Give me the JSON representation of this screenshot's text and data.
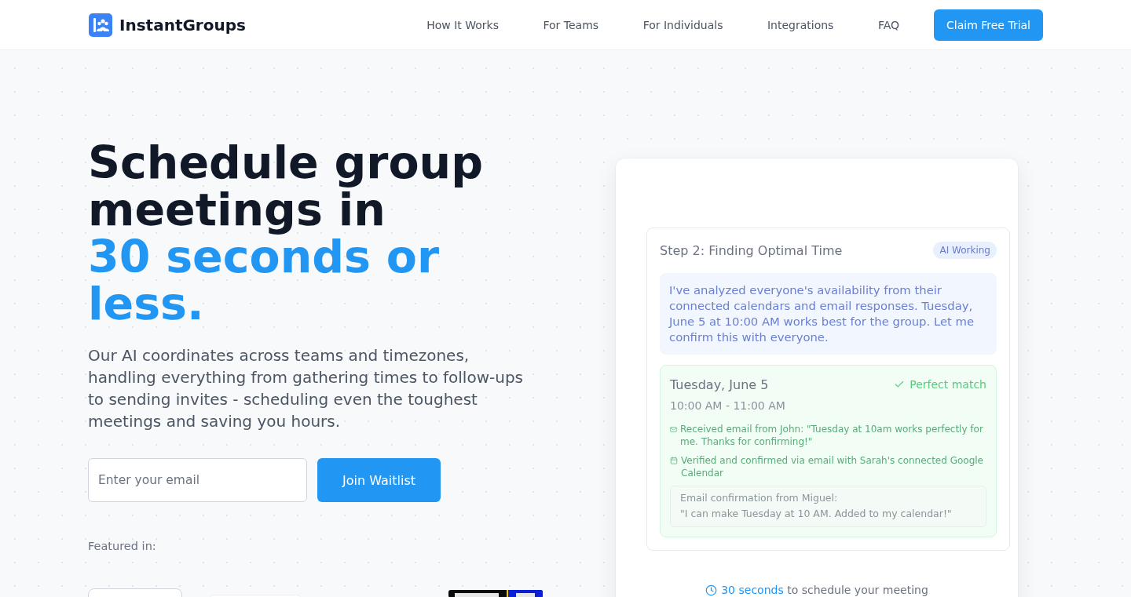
{
  "header": {
    "brand": "InstantGroups",
    "nav": [
      "How It Works",
      "For Teams",
      "For Individuals",
      "Integrations",
      "FAQ"
    ],
    "cta": "Claim Free Trial"
  },
  "hero": {
    "title": "Schedule group meetings in",
    "title_highlight": "30 seconds or less.",
    "description": "Our AI coordinates across teams and timezones, handling everything from gathering times to follow-ups to sending invites - scheduling even the toughest meetings and saving you hours.",
    "email_field": {
      "placeholder": "Enter your email"
    },
    "submit": "Join Waitlist",
    "featured_label": "Featured in:"
  },
  "demo": {
    "step_title": "Step 2: Finding Optimal Time",
    "status_badge": "AI Working",
    "ai_message": "I've analyzed everyone's availability from their connected calendars and email responses. Tuesday, June 5 at 10:00 AM works best for the group. Let me confirm this with everyone.",
    "match": {
      "date": "Tuesday, June 5",
      "status": "Perfect match",
      "time": "10:00 AM - 11:00 AM",
      "confirmations": [
        {
          "kind": "email",
          "text": "Received email from John: \"Tuesday at 10am works perfectly for me. Thanks for confirming!\""
        },
        {
          "kind": "calendar",
          "text": "Verified and confirmed via email with Sarah's connected Google Calendar"
        }
      ],
      "pending": {
        "title": "Email confirmation from Miguel:",
        "quote": "\"I can make Tuesday at 10 AM. Added to my calendar!\"",
        "faded": true
      }
    },
    "footer": {
      "highlight": "30 seconds",
      "text": "to schedule your meeting"
    }
  }
}
